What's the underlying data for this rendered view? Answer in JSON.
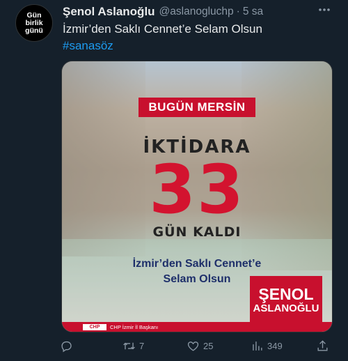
{
  "author": {
    "avatar_lines": [
      "Gün",
      "birlik",
      "günü"
    ],
    "name": "Şenol Aslanoğlu",
    "handle": "@aslanogluchp",
    "separator": "·",
    "time": "5 sa",
    "more_icon": "more-icon"
  },
  "tweet": {
    "text": "İzmir’den Saklı Cennet’e Selam Olsun",
    "hashtag": "#sanasöz"
  },
  "media": {
    "badge": "BUGÜN MERSİN",
    "headline": "İKTİDARA",
    "days": "33",
    "days_caption": "GÜN KALDI",
    "slogan_line1": "İzmir’den Saklı Cennet’e",
    "slogan_line2": "Selam Olsun",
    "brand_line1": "ŞENOL",
    "brand_line2": "ASLANOĞLU",
    "footer_logo": "CHP",
    "footer_text": "CHP İzmir İl Başkanı",
    "colors": {
      "accent_red": "#c8102e",
      "slogan_blue": "#1e2f6a"
    }
  },
  "actions": {
    "reply_icon": "reply-icon",
    "retweet_icon": "retweet-icon",
    "retweet_count": "7",
    "like_icon": "heart-icon",
    "like_count": "25",
    "views_icon": "views-icon",
    "views_count": "349",
    "share_icon": "share-icon"
  },
  "theme": {
    "background": "#15202b",
    "text": "#e7e9ea",
    "muted": "#8b98a5",
    "link": "#1d9bf0"
  }
}
